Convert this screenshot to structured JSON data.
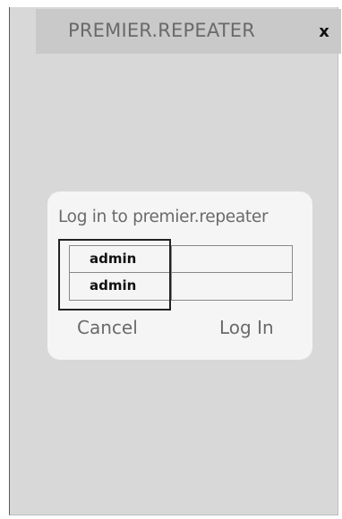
{
  "window": {
    "title": "PREMIER.REPEATER",
    "close_label": "x"
  },
  "dialog": {
    "title": "Log in to premier.repeater",
    "username_value": "admin",
    "password_value": "admin",
    "cancel_label": "Cancel",
    "login_label": "Log In"
  },
  "icons": {
    "close": "close-icon"
  },
  "colors": {
    "window_background": "#d8d8d8",
    "titlebar_background": "#c9c9c9",
    "dialog_background": "#f5f5f5",
    "text_muted": "#6a6a6a"
  }
}
